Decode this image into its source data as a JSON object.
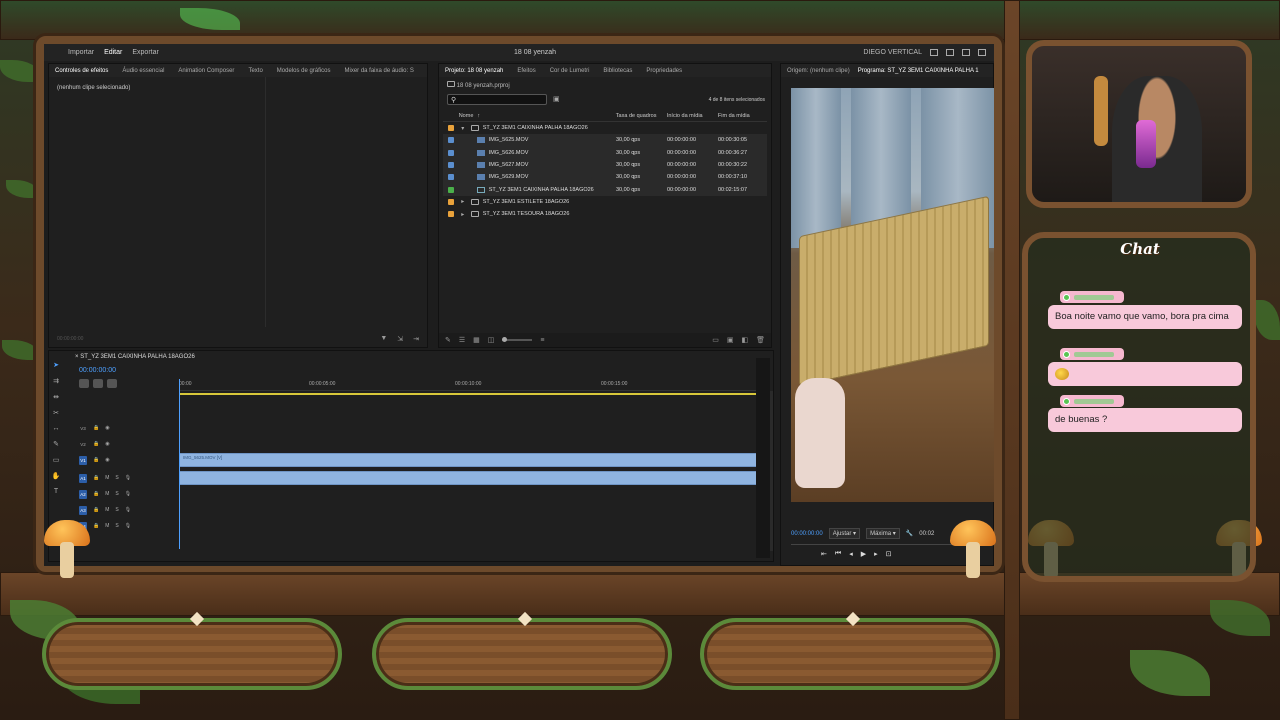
{
  "premiere": {
    "menu": {
      "import": "Importar",
      "edit": "Editar",
      "export": "Exportar"
    },
    "doc_title": "18 08 yenzah",
    "workspace": "DIEGO VERTICAL",
    "effects_tabs": [
      "Controles de efeitos",
      "Áudio essencial",
      "Animation Composer",
      "Texto",
      "Modelos de gráficos",
      "Mixer da faixa de áudio: S"
    ],
    "effects_noclip": "(nenhum clipe selecionado)",
    "effects_timecode": "00:00:00:00",
    "project_tabs": [
      "Projeto: 18 08 yenzah",
      "Efeitos",
      "Cor de Lumetri",
      "Bibliotecas",
      "Propriedades"
    ],
    "project_file": "18 08 yenzah.prproj",
    "selected_count": "4 de 8 itens selecionados",
    "columns": {
      "name": "Nome",
      "framerate": "Taxa de quadros",
      "media_start": "Início da mídia",
      "media_end": "Fim da mídia"
    },
    "rows": [
      {
        "name": "ST_YZ 3EM1 CAIXINHA PALHA 18AGO26",
        "fr": "",
        "start": "",
        "end": "",
        "color": "#e9a23b",
        "kind": "folder",
        "open": true,
        "indent": 0
      },
      {
        "name": "IMG_5625.MOV",
        "fr": "30,00 qps",
        "start": "00:00:00:00",
        "end": "00:00:30:05",
        "color": "#5b8fcf",
        "kind": "clip",
        "indent": 1
      },
      {
        "name": "IMG_5626.MOV",
        "fr": "30,00 qps",
        "start": "00:00:00:00",
        "end": "00:00:36:27",
        "color": "#5b8fcf",
        "kind": "clip",
        "indent": 1
      },
      {
        "name": "IMG_5627.MOV",
        "fr": "30,00 qps",
        "start": "00:00:00:00",
        "end": "00:00:30:22",
        "color": "#5b8fcf",
        "kind": "clip",
        "indent": 1
      },
      {
        "name": "IMG_5629.MOV",
        "fr": "30,00 qps",
        "start": "00:00:00:00",
        "end": "00:00:37:10",
        "color": "#5b8fcf",
        "kind": "clip",
        "indent": 1
      },
      {
        "name": "ST_YZ 3EM1 CAIXINHA PALHA 18AGO26",
        "fr": "30,00 qps",
        "start": "00:00:00:00",
        "end": "00:02:15:07",
        "color": "#4ab04a",
        "kind": "sequence",
        "indent": 1
      },
      {
        "name": "ST_YZ 3EM1 ESTILETE 18AGO26",
        "fr": "",
        "start": "",
        "end": "",
        "color": "#e9a23b",
        "kind": "folder",
        "open": false,
        "indent": 0
      },
      {
        "name": "ST_YZ 3EM1 TESOURA 18AGO26",
        "fr": "",
        "start": "",
        "end": "",
        "color": "#e9a23b",
        "kind": "folder",
        "open": false,
        "indent": 0
      }
    ],
    "program": {
      "source_tab": "Origem: (nenhum clipe)",
      "program_tab": "Programa: ST_YZ 3EM1 CAIXINHA PALHA 1",
      "timecode": "00:00:00:00",
      "fit": "Ajustar",
      "quality": "Máxima",
      "end_tc": "00:02"
    },
    "timeline": {
      "sequence": "ST_YZ 3EM1 CAIXINHA PALHA 18AGO26",
      "timecode": "00:00:00:00",
      "ruler": [
        "00:00",
        "00:00:05:00",
        "00:00:10:00",
        "00:00:15:00"
      ],
      "video_tracks": [
        "V3",
        "V2",
        "V1"
      ],
      "audio_tracks": [
        "A1",
        "A2",
        "A3",
        "A4"
      ],
      "clip_label": "IMG_5625.MOV [V]",
      "track_m": "M",
      "track_s": "S"
    }
  },
  "chat": {
    "title": "Chat",
    "messages": [
      {
        "text": "Boa noite vamo que vamo, bora pra cima"
      },
      {
        "text": ""
      },
      {
        "text": "de buenas ?"
      }
    ]
  }
}
